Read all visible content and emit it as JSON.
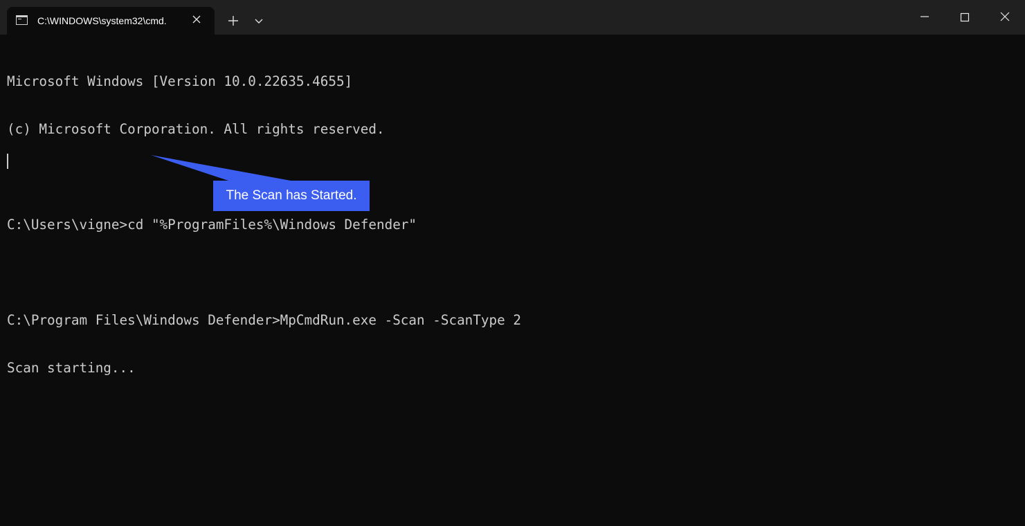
{
  "titlebar": {
    "tab_title": "C:\\WINDOWS\\system32\\cmd.",
    "tab_icon": "cmd-terminal-icon",
    "close_tab_icon": "close-icon",
    "new_tab_icon": "plus-icon",
    "dropdown_icon": "chevron-down-icon",
    "window_controls": [
      "minimize-icon",
      "maximize-icon",
      "close-icon"
    ]
  },
  "console": {
    "lines": [
      "Microsoft Windows [Version 10.0.22635.4655]",
      "(c) Microsoft Corporation. All rights reserved.",
      "",
      "C:\\Users\\vigne>cd \"%ProgramFiles%\\Windows Defender\"",
      "",
      "C:\\Program Files\\Windows Defender>MpCmdRun.exe -Scan -ScanType 2",
      "Scan starting..."
    ]
  },
  "annotation": {
    "text": "The Scan has Started.",
    "color": "#3c5ef0"
  },
  "colors": {
    "background": "#0c0c0c",
    "titlebar": "#202020",
    "text": "#cccccc"
  }
}
